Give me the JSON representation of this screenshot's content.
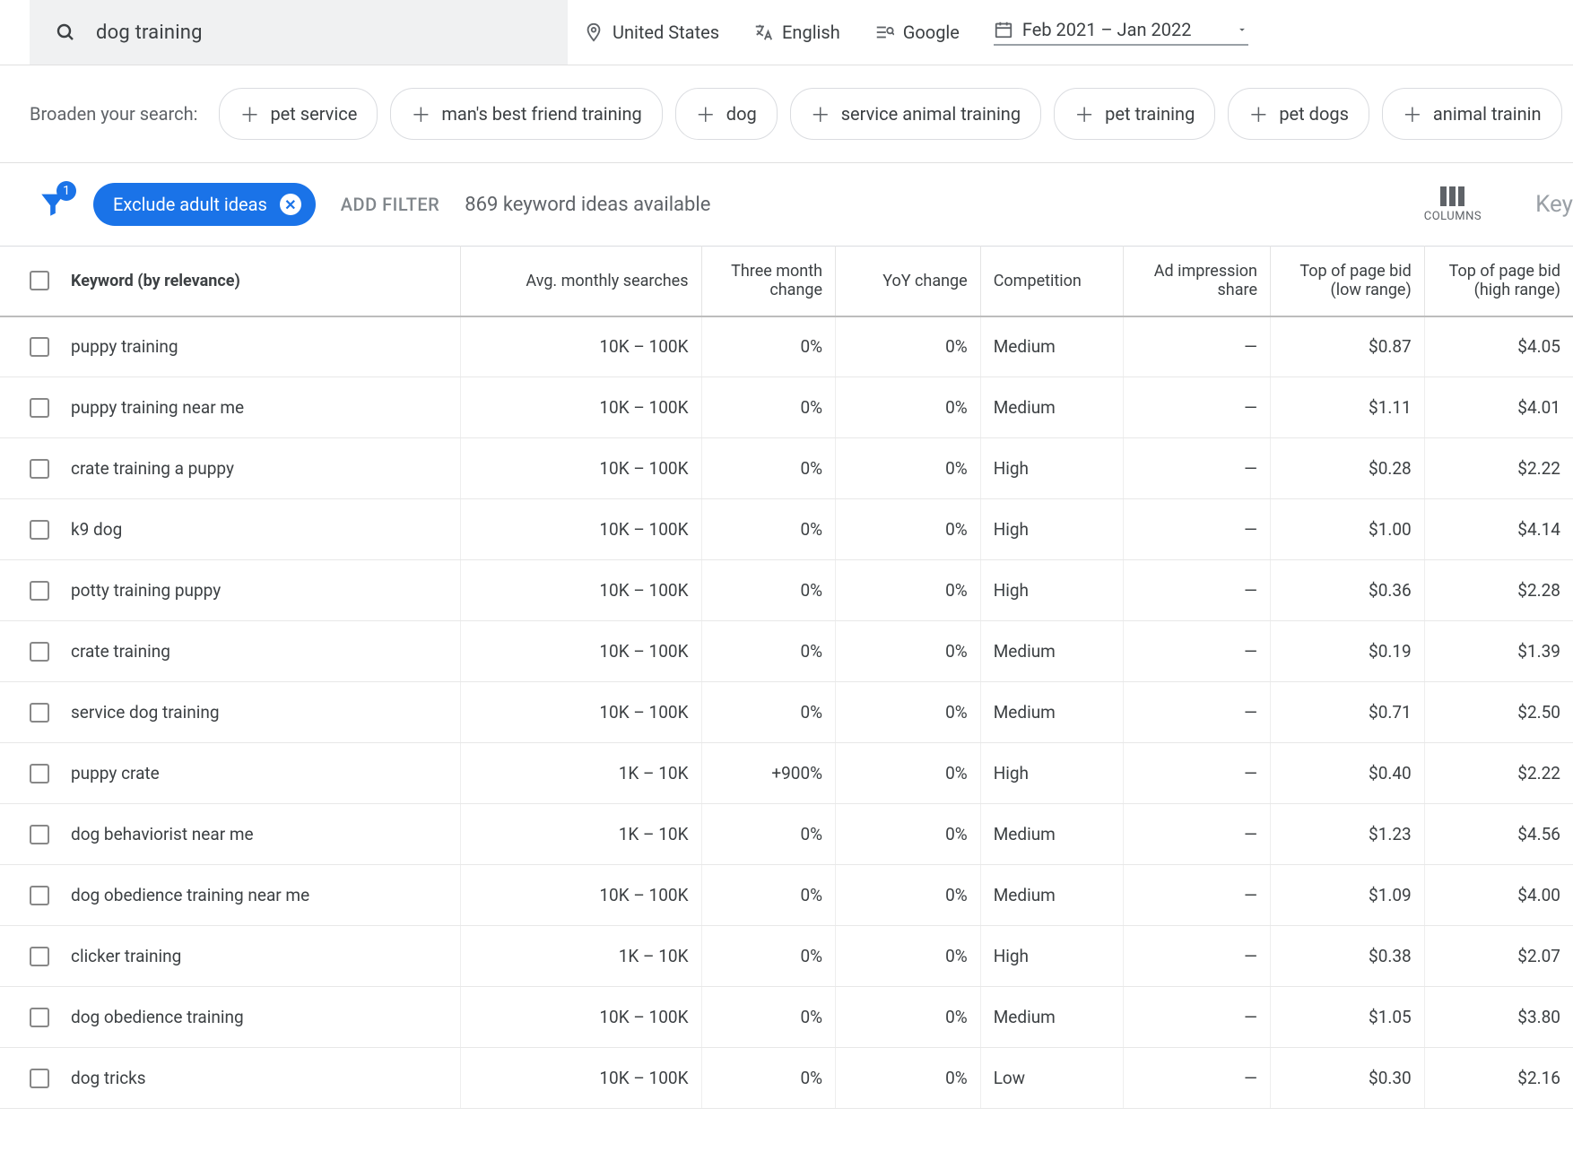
{
  "search": {
    "term": "dog training"
  },
  "targeting": {
    "location": "United States",
    "language": "English",
    "network": "Google",
    "date_range": "Feb 2021 – Jan 2022"
  },
  "broaden": {
    "label": "Broaden your search:",
    "suggestions": [
      "pet service",
      "man's best friend training",
      "dog",
      "service animal training",
      "pet training",
      "pet dogs",
      "animal trainin"
    ]
  },
  "filters": {
    "funnel_badge": "1",
    "active_chip": "Exclude adult ideas",
    "add_filter": "ADD FILTER",
    "available_text": "869 keyword ideas available",
    "columns_label": "COLUMNS",
    "right_cut": "Key"
  },
  "columns": {
    "keyword": "Keyword (by relevance)",
    "avg": "Avg. monthly searches",
    "three_mo": "Three month change",
    "yoy": "YoY change",
    "competition": "Competition",
    "ad_share": "Ad impression share",
    "bid_low": "Top of page bid (low range)",
    "bid_high": "Top of page bid (high range)"
  },
  "rows": [
    {
      "keyword": "puppy training",
      "avg": "10K – 100K",
      "three_mo": "0%",
      "yoy": "0%",
      "comp": "Medium",
      "ad": "—",
      "low": "$0.87",
      "high": "$4.05"
    },
    {
      "keyword": "puppy training near me",
      "avg": "10K – 100K",
      "three_mo": "0%",
      "yoy": "0%",
      "comp": "Medium",
      "ad": "—",
      "low": "$1.11",
      "high": "$4.01"
    },
    {
      "keyword": "crate training a puppy",
      "avg": "10K – 100K",
      "three_mo": "0%",
      "yoy": "0%",
      "comp": "High",
      "ad": "—",
      "low": "$0.28",
      "high": "$2.22"
    },
    {
      "keyword": "k9 dog",
      "avg": "10K – 100K",
      "three_mo": "0%",
      "yoy": "0%",
      "comp": "High",
      "ad": "—",
      "low": "$1.00",
      "high": "$4.14"
    },
    {
      "keyword": "potty training puppy",
      "avg": "10K – 100K",
      "three_mo": "0%",
      "yoy": "0%",
      "comp": "High",
      "ad": "—",
      "low": "$0.36",
      "high": "$2.28"
    },
    {
      "keyword": "crate training",
      "avg": "10K – 100K",
      "three_mo": "0%",
      "yoy": "0%",
      "comp": "Medium",
      "ad": "—",
      "low": "$0.19",
      "high": "$1.39"
    },
    {
      "keyword": "service dog training",
      "avg": "10K – 100K",
      "three_mo": "0%",
      "yoy": "0%",
      "comp": "Medium",
      "ad": "—",
      "low": "$0.71",
      "high": "$2.50"
    },
    {
      "keyword": "puppy crate",
      "avg": "1K – 10K",
      "three_mo": "+900%",
      "yoy": "0%",
      "comp": "High",
      "ad": "—",
      "low": "$0.40",
      "high": "$2.22"
    },
    {
      "keyword": "dog behaviorist near me",
      "avg": "1K – 10K",
      "three_mo": "0%",
      "yoy": "0%",
      "comp": "Medium",
      "ad": "—",
      "low": "$1.23",
      "high": "$4.56"
    },
    {
      "keyword": "dog obedience training near me",
      "avg": "10K – 100K",
      "three_mo": "0%",
      "yoy": "0%",
      "comp": "Medium",
      "ad": "—",
      "low": "$1.09",
      "high": "$4.00"
    },
    {
      "keyword": "clicker training",
      "avg": "1K – 10K",
      "three_mo": "0%",
      "yoy": "0%",
      "comp": "High",
      "ad": "—",
      "low": "$0.38",
      "high": "$2.07"
    },
    {
      "keyword": "dog obedience training",
      "avg": "10K – 100K",
      "three_mo": "0%",
      "yoy": "0%",
      "comp": "Medium",
      "ad": "—",
      "low": "$1.05",
      "high": "$3.80"
    },
    {
      "keyword": "dog tricks",
      "avg": "10K – 100K",
      "three_mo": "0%",
      "yoy": "0%",
      "comp": "Low",
      "ad": "—",
      "low": "$0.30",
      "high": "$2.16"
    }
  ]
}
